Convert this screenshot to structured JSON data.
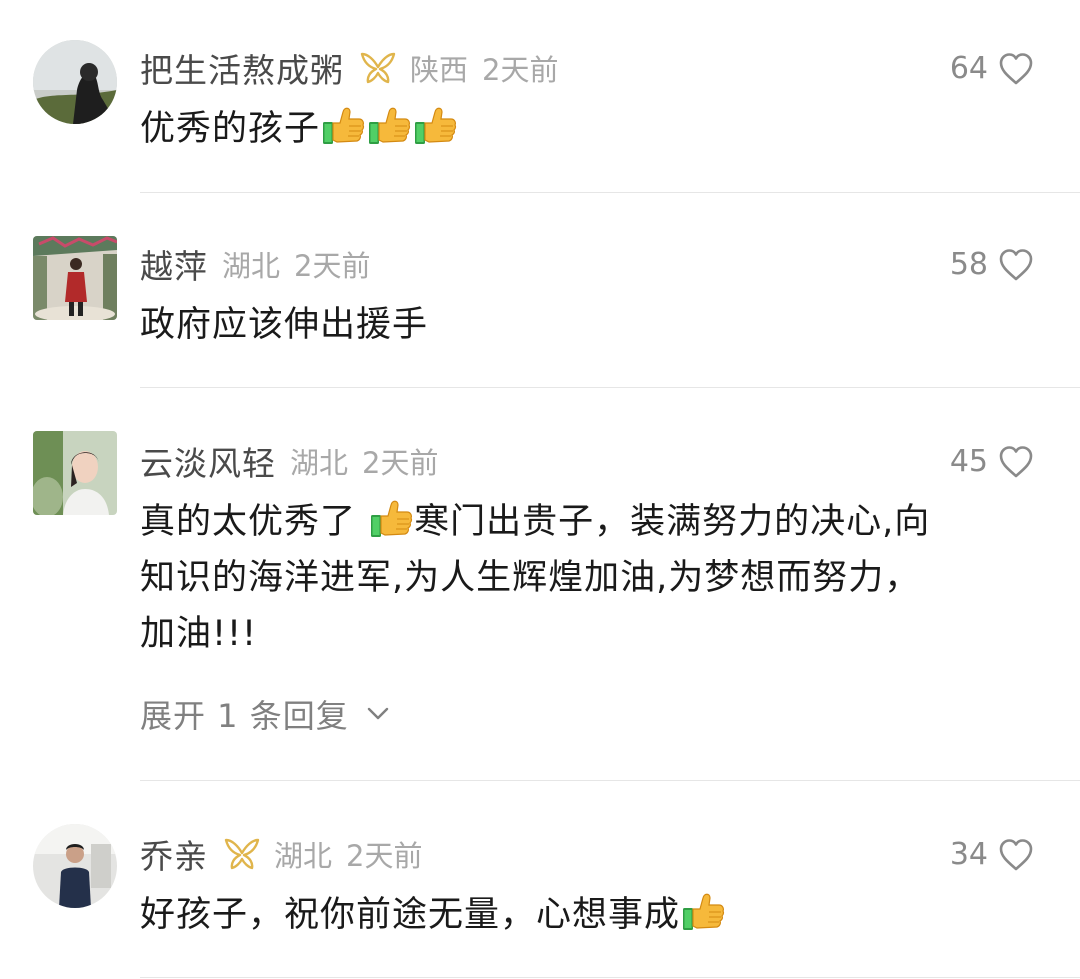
{
  "comments": [
    {
      "username": "把生活熬成粥",
      "has_badge": true,
      "location": "陕西",
      "time": "2天前",
      "likes": "64",
      "text": "优秀的孩子",
      "emoji_count": 3
    },
    {
      "username": "越萍",
      "has_badge": false,
      "location": "湖北",
      "time": "2天前",
      "likes": "58",
      "text": "政府应该伸出援手"
    },
    {
      "username": "云淡风轻",
      "has_badge": false,
      "location": "湖北",
      "time": "2天前",
      "likes": "45",
      "text_before_emoji": "真的太优秀了 ",
      "text_after_emoji": "寒门出贵子，装满努力的决心,向",
      "text_line2": "知识的海洋进军,为人生辉煌加油,为梦想而努力，",
      "text_line3": "加油!!!",
      "expand_label": "展开 1 条回复"
    },
    {
      "username": "乔亲",
      "has_badge": true,
      "location": "湖北",
      "time": "2天前",
      "likes": "34",
      "text": "好孩子，祝你前途无量，心想事成"
    }
  ],
  "colors": {
    "username": "#4a4a4a",
    "meta": "#a8a8a8",
    "body": "#1a1a1a",
    "badge": "#e0b54c",
    "divider": "#e6e6e6"
  },
  "icons": {
    "like": "heart-outline-icon",
    "badge": "fan-badge-icon",
    "expand": "chevron-down-icon",
    "emoji": "thumbs-up-emoji"
  }
}
